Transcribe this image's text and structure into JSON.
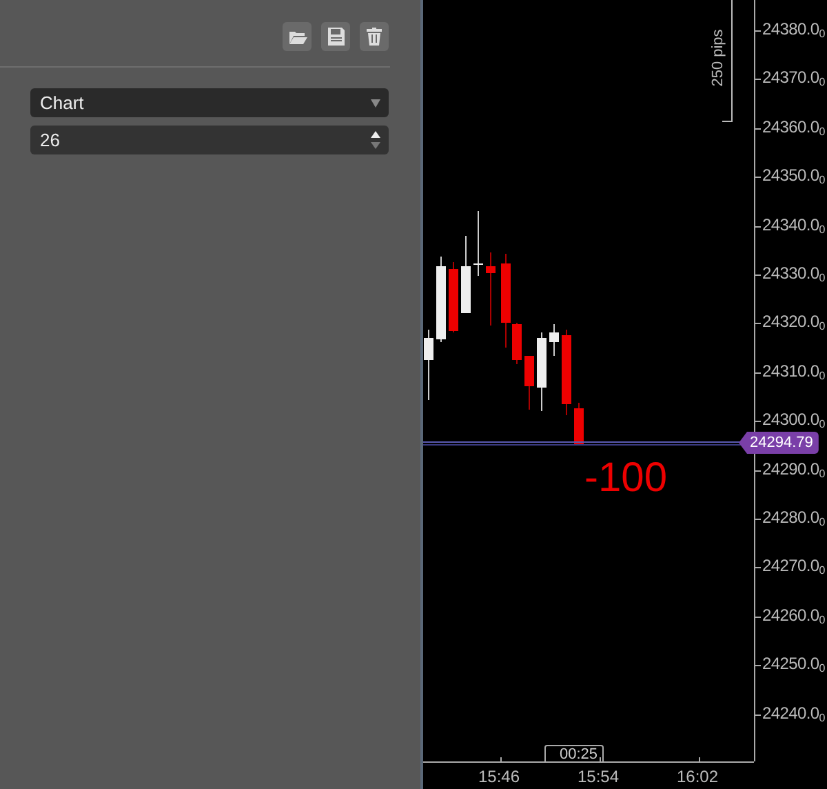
{
  "chart_type_select": {
    "value": "Chart"
  },
  "period_field": {
    "value": "26"
  },
  "chart": {
    "ruler_label": "250 pips",
    "price_axis": [
      "24380.0$_{0}$",
      "24370.0$_{0}$",
      "24360.0$_{0}$",
      "24350.0$_{0}$",
      "24340.0$_{0}$",
      "24330.0$_{0}$",
      "24320.0$_{0}$",
      "24310.0$_{0}$",
      "24300.0$_{0}$",
      "24290.0$_{0}$",
      "24280.0$_{0}$",
      "24270.0$_{0}$",
      "24260.0$_{0}$",
      "24250.0$_{0}$",
      "24240.0$_{0}$"
    ],
    "current_price": "24294.79",
    "annotation": "-100",
    "countdown": "00:25",
    "time_axis": [
      "15:46",
      "15:54",
      "16:02"
    ]
  }
}
